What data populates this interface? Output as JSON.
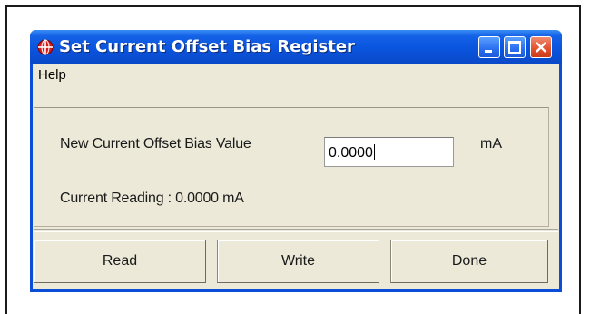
{
  "window": {
    "title": "Set Current Offset Bias Register",
    "icon": "red-globe-icon",
    "controls": [
      "minimize-icon",
      "maximize-icon",
      "close-icon"
    ]
  },
  "menu": {
    "items": [
      "Help"
    ]
  },
  "form": {
    "new_value_label": "New Current Offset Bias Value",
    "new_value": "0.0000",
    "unit": "mA",
    "reading_label": "Current Reading : 0.0000 mA"
  },
  "buttons": {
    "read": "Read",
    "write": "Write",
    "done": "Done"
  },
  "colors": {
    "titlebar": "#0a54de",
    "client": "#ece9d8",
    "close_button": "#e0502c"
  }
}
